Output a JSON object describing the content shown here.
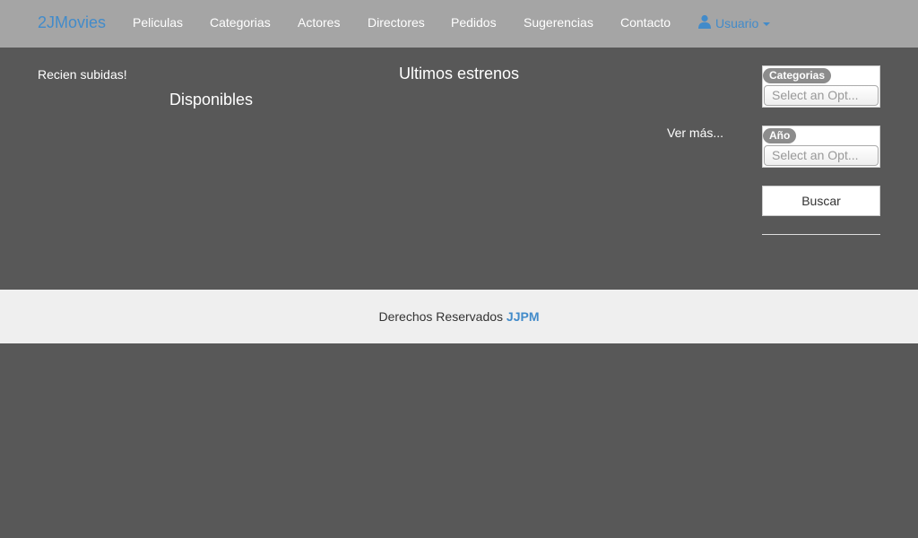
{
  "navbar": {
    "brand": "2JMovies",
    "items": [
      {
        "label": "Peliculas"
      },
      {
        "label": "Categorias"
      },
      {
        "label": "Actores"
      },
      {
        "label": "Directores"
      },
      {
        "label": "Pedidos"
      },
      {
        "label": "Sugerencias"
      },
      {
        "label": "Contacto"
      }
    ],
    "user_label": "Usuario",
    "user_icon": "user-icon",
    "background": "#a5a5a5",
    "accent": "#428bca"
  },
  "main": {
    "recent_heading": "Recien subidas!",
    "available_heading": "Disponibles",
    "releases_heading": "Ultimos estrenos",
    "see_more": "Ver más..."
  },
  "sidebar": {
    "category_filter": {
      "label": "Categorias",
      "placeholder": "Select an Opt..."
    },
    "year_filter": {
      "label": "Año",
      "placeholder": "Select an Opt..."
    },
    "search_button": "Buscar"
  },
  "footer": {
    "text": "Derechos Reservados",
    "brand": "JJPM"
  }
}
